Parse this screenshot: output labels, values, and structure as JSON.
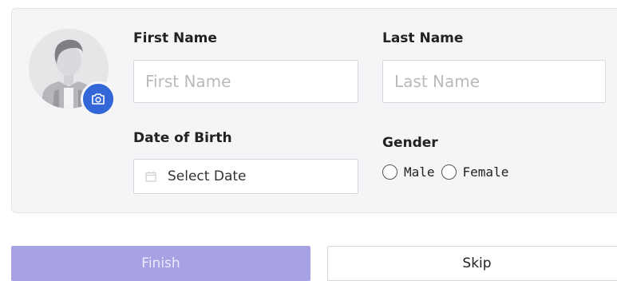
{
  "profile_form": {
    "first_name": {
      "label": "First Name",
      "placeholder": "First Name",
      "value": ""
    },
    "last_name": {
      "label": "Last Name",
      "placeholder": "Last Name",
      "value": ""
    },
    "date_of_birth": {
      "label": "Date of Birth",
      "display_text": "Select Date",
      "icon": "calendar-icon"
    },
    "gender": {
      "label": "Gender",
      "options": [
        "Male",
        "Female"
      ],
      "selected": null
    },
    "avatar": {
      "icon": "user-silhouette-icon",
      "upload_icon": "camera-icon",
      "upload_color": "#3366d6"
    }
  },
  "actions": {
    "finish_label": "Finish",
    "skip_label": "Skip",
    "finish_color": "#a7a2e4"
  }
}
